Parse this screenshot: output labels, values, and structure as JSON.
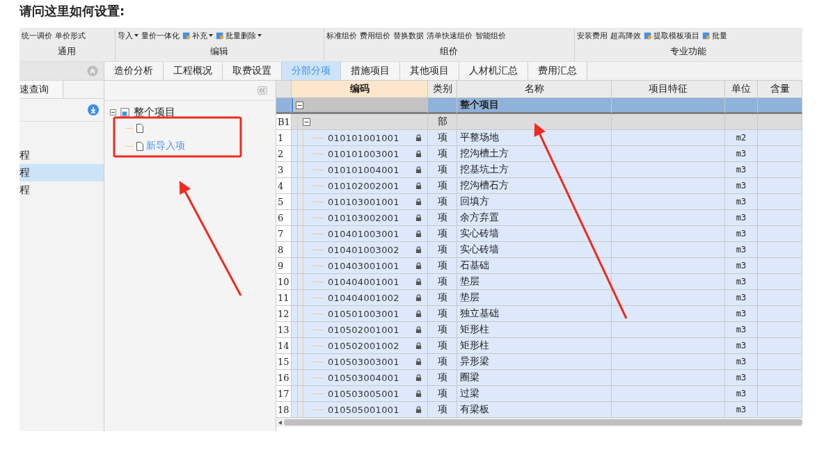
{
  "question": "请问这里如何设置:",
  "toolbar": {
    "groups": [
      {
        "label": "通用",
        "tools": [
          {
            "label": "统一调价",
            "icon": false,
            "dropdown": false
          },
          {
            "label": "单价形式",
            "icon": false,
            "dropdown": false
          }
        ]
      },
      {
        "label": "编辑",
        "tools": [
          {
            "label": "导入",
            "icon": false,
            "dropdown": true
          },
          {
            "label": "量价一体化",
            "icon": false,
            "dropdown": false
          },
          {
            "label": "补充",
            "icon": true,
            "dropdown": true
          },
          {
            "label": "批量删除",
            "icon": true,
            "dropdown": true
          }
        ]
      },
      {
        "label": "组价",
        "tools": [
          {
            "label": "标准组价",
            "icon": false,
            "dropdown": false
          },
          {
            "label": "费用组价",
            "icon": false,
            "dropdown": false
          },
          {
            "label": "替换数据",
            "icon": false,
            "dropdown": false
          },
          {
            "label": "清单快速组价",
            "icon": false,
            "dropdown": false
          },
          {
            "label": "智能组价",
            "icon": false,
            "dropdown": false
          }
        ]
      },
      {
        "label": "专业功能",
        "tools": [
          {
            "label": "安装费用",
            "icon": false,
            "dropdown": false
          },
          {
            "label": "超高降效",
            "icon": false,
            "dropdown": false
          },
          {
            "label": "提取模板项目",
            "icon": true,
            "dropdown": false
          },
          {
            "label": "批量",
            "icon": true,
            "dropdown": false
          }
        ]
      }
    ]
  },
  "left_panel": {
    "tab": "速查询",
    "items": [
      {
        "label": "程",
        "selected": false
      },
      {
        "label": "程",
        "selected": true
      },
      {
        "label": "程",
        "selected": false
      }
    ]
  },
  "tabs": [
    {
      "label": "造价分析",
      "selected": false
    },
    {
      "label": "工程概况",
      "selected": false
    },
    {
      "label": "取费设置",
      "selected": false
    },
    {
      "label": "分部分项",
      "selected": true
    },
    {
      "label": "措施项目",
      "selected": false
    },
    {
      "label": "其他项目",
      "selected": false
    },
    {
      "label": "人材机汇总",
      "selected": false
    },
    {
      "label": "费用汇总",
      "selected": false
    }
  ],
  "tree": {
    "label": "整个项目",
    "expanded": true,
    "children": [
      {
        "kind": "document"
      },
      {
        "kind": "document",
        "label": "新导入项"
      }
    ]
  },
  "table": {
    "columns": [
      "编码",
      "类别",
      "名称",
      "项目特征",
      "单位",
      "含量"
    ],
    "rows": [
      {
        "kind": "root",
        "name": "整个项目",
        "selected": true
      },
      {
        "kind": "section",
        "number": "B1",
        "type": "部"
      },
      {
        "kind": "item",
        "number": "1",
        "code": "010101001001",
        "type": "项",
        "name": "平整场地",
        "unit": "m2",
        "locked": true
      },
      {
        "kind": "item",
        "number": "2",
        "code": "010101003001",
        "type": "项",
        "name": "挖沟槽土方",
        "unit": "m3",
        "locked": true
      },
      {
        "kind": "item",
        "number": "3",
        "code": "010101004001",
        "type": "项",
        "name": "挖基坑土方",
        "unit": "m3",
        "locked": true
      },
      {
        "kind": "item",
        "number": "4",
        "code": "010102002001",
        "type": "项",
        "name": "挖沟槽石方",
        "unit": "m3",
        "locked": true
      },
      {
        "kind": "item",
        "number": "5",
        "code": "010103001001",
        "type": "项",
        "name": "回填方",
        "unit": "m3",
        "locked": true
      },
      {
        "kind": "item",
        "number": "6",
        "code": "010103002001",
        "type": "项",
        "name": "余方弃置",
        "unit": "m3",
        "locked": true
      },
      {
        "kind": "item",
        "number": "7",
        "code": "010401003001",
        "type": "项",
        "name": "实心砖墙",
        "unit": "m3",
        "locked": true
      },
      {
        "kind": "item",
        "number": "8",
        "code": "010401003002",
        "type": "项",
        "name": "实心砖墙",
        "unit": "m3",
        "locked": true
      },
      {
        "kind": "item",
        "number": "9",
        "code": "010403001001",
        "type": "项",
        "name": "石基础",
        "unit": "m3",
        "locked": true
      },
      {
        "kind": "item",
        "number": "10",
        "code": "010404001001",
        "type": "项",
        "name": "垫层",
        "unit": "m3",
        "locked": true
      },
      {
        "kind": "item",
        "number": "11",
        "code": "010404001002",
        "type": "项",
        "name": "垫层",
        "unit": "m3",
        "locked": true
      },
      {
        "kind": "item",
        "number": "12",
        "code": "010501003001",
        "type": "项",
        "name": "独立基础",
        "unit": "m3",
        "locked": true
      },
      {
        "kind": "item",
        "number": "13",
        "code": "010502001001",
        "type": "项",
        "name": "矩形柱",
        "unit": "m3",
        "locked": true
      },
      {
        "kind": "item",
        "number": "14",
        "code": "010502001002",
        "type": "项",
        "name": "矩形柱",
        "unit": "m3",
        "locked": true
      },
      {
        "kind": "item",
        "number": "15",
        "code": "010503003001",
        "type": "项",
        "name": "异形梁",
        "unit": "m3",
        "locked": true
      },
      {
        "kind": "item",
        "number": "16",
        "code": "010503004001",
        "type": "项",
        "name": "圈梁",
        "unit": "m3",
        "locked": true
      },
      {
        "kind": "item",
        "number": "17",
        "code": "010503005001",
        "type": "项",
        "name": "过梁",
        "unit": "m3",
        "locked": true
      },
      {
        "kind": "item",
        "number": "18",
        "code": "010505001001",
        "type": "项",
        "name": "有梁板",
        "unit": "m3",
        "locked": true
      }
    ]
  }
}
